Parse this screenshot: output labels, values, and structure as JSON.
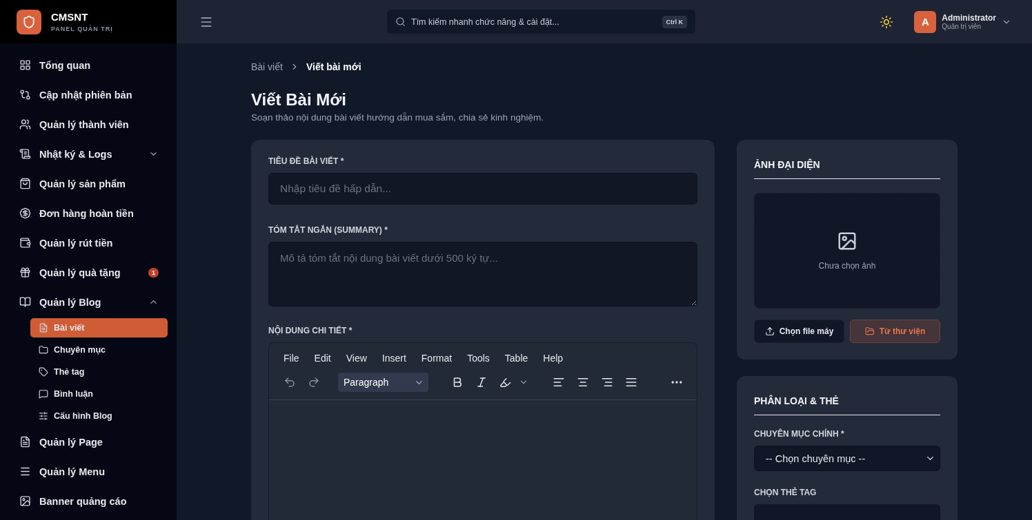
{
  "brand": {
    "name": "CMSNT",
    "subtitle": "PANEL QUẢN TRỊ"
  },
  "sidebar": {
    "items": [
      {
        "label": "Tổng quan",
        "selected": false
      },
      {
        "label": "Cập nhật phiên bản",
        "selected": false
      },
      {
        "label": "Quản lý thành viên",
        "selected": false
      },
      {
        "label": "Nhật ký & Logs",
        "selected": false,
        "expanded": false
      },
      {
        "label": "Quản lý sản phẩm",
        "selected": false
      },
      {
        "label": "Đơn hàng hoàn tiền",
        "selected": false
      },
      {
        "label": "Quản lý rút tiền",
        "selected": false
      },
      {
        "label": "Quản lý quà tặng",
        "selected": false,
        "badge": "1"
      },
      {
        "label": "Quản lý Blog",
        "selected": false,
        "expanded": true,
        "children": [
          {
            "label": "Bài viết",
            "selected": true
          },
          {
            "label": "Chuyên mục",
            "selected": false
          },
          {
            "label": "Thẻ tag",
            "selected": false
          },
          {
            "label": "Bình luận",
            "selected": false
          },
          {
            "label": "Cấu hình Blog",
            "selected": false
          }
        ]
      },
      {
        "label": "Quản lý Page",
        "selected": false
      },
      {
        "label": "Quản lý Menu",
        "selected": false
      },
      {
        "label": "Banner quảng cáo",
        "selected": false
      }
    ]
  },
  "header": {
    "search_placeholder": "Tìm kiếm nhanh chức năng & cài đặt...",
    "shortcut": "Ctrl K",
    "user": {
      "initial": "A",
      "name": "Administrator",
      "role": "Quản trị viên"
    }
  },
  "breadcrumb": [
    "Bài viết",
    "Viết bài mới"
  ],
  "page": {
    "title": "Viết Bài Mới",
    "subtitle": "Soạn thảo nội dung bài viết hướng dẫn mua sắm, chia sẻ kinh nghiệm."
  },
  "form": {
    "title_label": "TIÊU ĐỀ BÀI VIẾT *",
    "title_placeholder": "Nhập tiêu đề hấp dẫn...",
    "summary_label": "TÓM TẮT NGẮN (SUMMARY) *",
    "summary_placeholder": "Mô tả tóm tắt nội dung bài viết dưới 500 ký tự...",
    "content_label": "NỘI DUNG CHI TIẾT *",
    "editor": {
      "menu": [
        "File",
        "Edit",
        "View",
        "Insert",
        "Format",
        "Tools",
        "Table",
        "Help"
      ],
      "block_format": "Paragraph"
    }
  },
  "thumbnail": {
    "title": "ẢNH ĐẠI DIỆN",
    "empty_text": "Chưa chọn ảnh",
    "buttons": [
      {
        "label": "Chọn file máy",
        "kind": "upload"
      },
      {
        "label": "Từ thư viện",
        "kind": "library"
      }
    ]
  },
  "taxonomy": {
    "title": "PHÂN LOẠI & THẺ",
    "category_label": "CHUYÊN MỤC CHÍNH *",
    "category_value": "-- Chọn chuyên mục --",
    "tags_label": "CHỌN THẺ TAG"
  }
}
